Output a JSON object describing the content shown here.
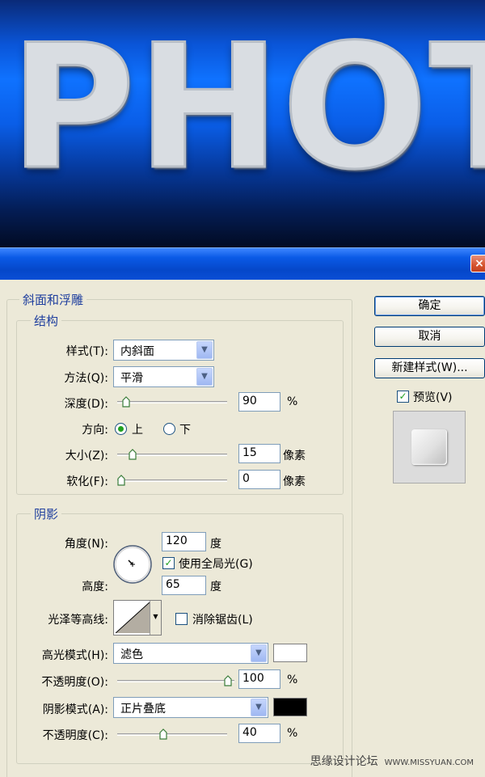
{
  "banner": {
    "text": "PHOT"
  },
  "window": {
    "close_symbol": "×"
  },
  "group_main": "斜面和浮雕",
  "structure": {
    "title": "结构",
    "style_label": "样式(T):",
    "style_value": "内斜面",
    "technique_label": "方法(Q):",
    "technique_value": "平滑",
    "depth_label": "深度(D):",
    "depth_value": "90",
    "depth_unit": "%",
    "direction_label": "方向:",
    "direction_up": "上",
    "direction_down": "下",
    "direction_selected": "上",
    "size_label": "大小(Z):",
    "size_value": "15",
    "size_unit": "像素",
    "soften_label": "软化(F):",
    "soften_value": "0",
    "soften_unit": "像素"
  },
  "shading": {
    "title": "阴影",
    "angle_label": "角度(N):",
    "angle_value": "120",
    "angle_unit": "度",
    "global_light_label": "使用全局光(G)",
    "global_light_checked": true,
    "altitude_label": "高度:",
    "altitude_value": "65",
    "altitude_unit": "度",
    "gloss_contour_label": "光泽等高线:",
    "anti_aliased_label": "消除锯齿(L)",
    "anti_aliased_checked": false,
    "highlight_mode_label": "高光模式(H):",
    "highlight_mode_value": "滤色",
    "highlight_color": "#ffffff",
    "highlight_opacity_label": "不透明度(O):",
    "highlight_opacity_value": "100",
    "highlight_opacity_unit": "%",
    "shadow_mode_label": "阴影模式(A):",
    "shadow_mode_value": "正片叠底",
    "shadow_color": "#000000",
    "shadow_opacity_label": "不透明度(C):",
    "shadow_opacity_value": "40",
    "shadow_opacity_unit": "%"
  },
  "buttons": {
    "ok": "确定",
    "cancel": "取消",
    "new_style": "新建样式(W)...",
    "preview_label": "预览(V)",
    "preview_checked": true
  },
  "watermark": {
    "text": "思缘设计论坛",
    "url": "WWW.MISSYUAN.COM"
  }
}
